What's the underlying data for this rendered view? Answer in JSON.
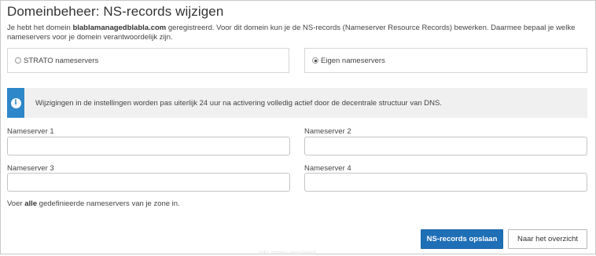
{
  "page": {
    "title": "Domeinbeheer: NS-records wijzigen",
    "intro_prefix": "Je hebt het domein ",
    "domain": "blablamanagedblabla.com",
    "intro_suffix": " geregistreerd. Voor dit domein kun je de NS-records (Nameserver Resource Records) bewerken. Daarmee bepaal je welke nameservers voor je domein verantwoordelijk zijn."
  },
  "options": {
    "strato_label": "STRATO nameservers",
    "eigen_label": "Eigen nameservers",
    "selected": "eigen"
  },
  "info": {
    "icon": "info-icon",
    "text": "Wijzigingen in de instellingen worden pas uiterlijk 24 uur na activering volledig actief door de decentrale structuur van DNS.",
    "icon_color": "#2e87c8"
  },
  "fields": {
    "ns1_label": "Nameserver 1",
    "ns1_value": "",
    "ns2_label": "Nameserver 2",
    "ns2_value": "",
    "ns3_label": "Nameserver 3",
    "ns3_value": "",
    "ns4_label": "Nameserver 4",
    "ns4_value": ""
  },
  "hint": {
    "prefix": "Voer ",
    "bold": "alle",
    "suffix": " gedefinieerde nameservers van je zone in."
  },
  "actions": {
    "save_label": "NS-records opslaan",
    "back_label": "Naar het overzicht",
    "primary_color": "#1f6fb7"
  },
  "footer": {
    "faint_text": "info.strato-sessionid"
  }
}
